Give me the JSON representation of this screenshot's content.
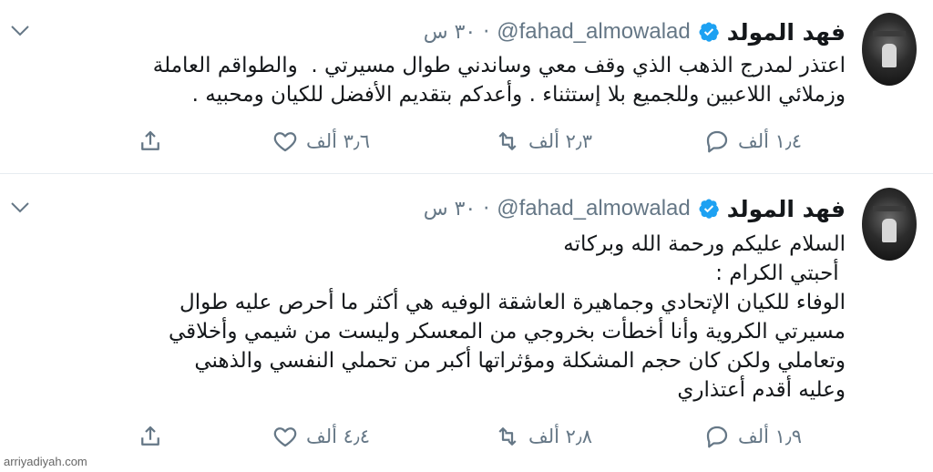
{
  "tweets": [
    {
      "name": "فهد المولد",
      "handle": "@fahad_almowalad",
      "separator": "·",
      "time": "٣٠ س",
      "text": "اعتذر لمدرج الذهب الذي وقف معي وساندني طوال مسيرتي .  والطواقم العاملة\nوزملائي اللاعبين وللجميع بلا إستثناء . وأعدكم بتقديم الأفضل للكيان ومحبيه .",
      "replies": "١٫٤ ألف",
      "retweets": "٢٫٣ ألف",
      "likes": "٣٫٦ ألف"
    },
    {
      "name": "فهد المولد",
      "handle": "@fahad_almowalad",
      "separator": "·",
      "time": "٣٠ س",
      "text": "السلام عليكم ورحمة الله وبركاته\n أحبتي الكرام :\nالوفاء للكيان الإتحادي وجماهيرة العاشقة الوفيه هي أكثر ما أحرص عليه طوال\nمسيرتي الكروية وأنا أخطأت بخروجي من المعسكر وليست من شيمي وأخلاقي\nوتعاملي ولكن كان حجم المشكلة ومؤثراتها أكبر من تحملي النفسي والذهني\nوعليه أقدم أعتذاري",
      "replies": "١٫٩ ألف",
      "retweets": "٢٫٨ ألف",
      "likes": "٤٫٤ ألف"
    }
  ],
  "watermark": "arriyadiyah.com",
  "colors": {
    "verified": "#1da1f2",
    "muted": "#657786",
    "text": "#14171a"
  },
  "icons": [
    "reply-icon",
    "retweet-icon",
    "like-icon",
    "share-icon",
    "verified-badge-icon",
    "chevron-down-icon"
  ]
}
